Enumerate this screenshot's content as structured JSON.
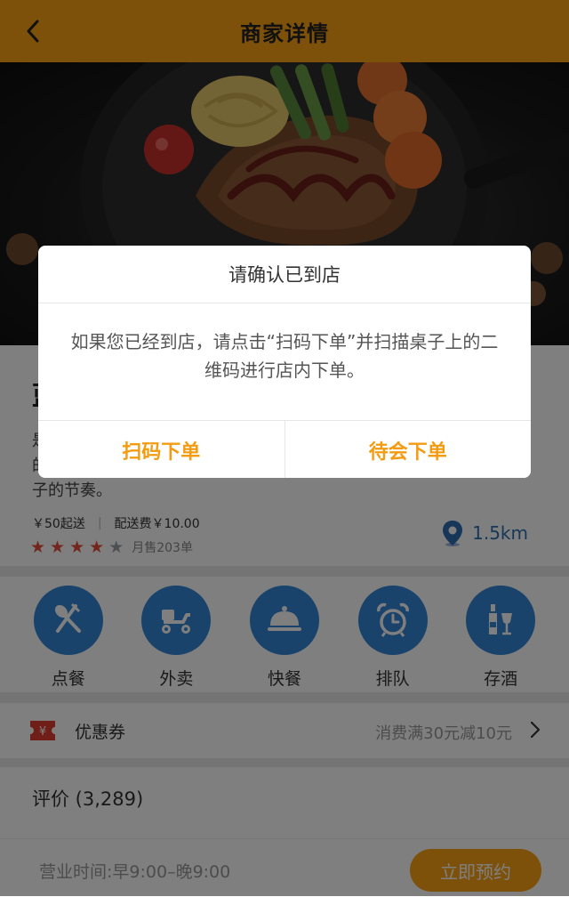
{
  "header": {
    "title": "商家详情",
    "back_icon": "chevron-left-icon",
    "color": "#fca215"
  },
  "merchant": {
    "name": "蓝",
    "description": "是  的  子的节奏。",
    "desc_lines": [
      "是",
      "的",
      "子的节奏。"
    ],
    "min_order": "￥50起送",
    "delivery_fee": "配送费￥10.00",
    "rating": 4,
    "rating_max": 5,
    "sold": "月售203单",
    "distance": "1.5km"
  },
  "services": [
    {
      "label": "点餐",
      "icon": "utensils-icon"
    },
    {
      "label": "外卖",
      "icon": "scooter-icon"
    },
    {
      "label": "快餐",
      "icon": "cloche-icon"
    },
    {
      "label": "排队",
      "icon": "alarm-clock-icon"
    },
    {
      "label": "存酒",
      "icon": "wine-icon"
    }
  ],
  "coupon": {
    "label": "优惠券",
    "promo": "消费满30元减10元"
  },
  "reviews": {
    "label": "评价 (3,289)"
  },
  "bottom": {
    "hours": "营业时间:早9:00–晚9:00",
    "reserve": "立即预约"
  },
  "dialog": {
    "title": "请确认已到店",
    "message": "如果您已经到店，请点击“扫码下单”并扫描桌子上的二维码进行店内下单。",
    "buttons": [
      "扫码下单",
      "待会下单"
    ]
  }
}
